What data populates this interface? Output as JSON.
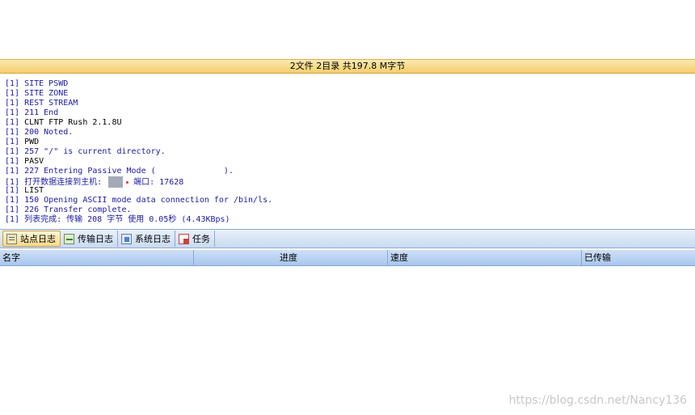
{
  "status_bar": {
    "text": "2文件 2目录 共197.8 M字节"
  },
  "log": [
    {
      "tag": "[1]",
      "text": " SITE PSWD",
      "color": "blue"
    },
    {
      "tag": "[1]",
      "text": " SITE ZONE",
      "color": "blue"
    },
    {
      "tag": "[1]",
      "text": " REST STREAM",
      "color": "blue"
    },
    {
      "tag": "[1]",
      "text": " 211 End",
      "color": "blue"
    },
    {
      "tag": "[1]",
      "text": " CLNT FTP Rush 2.1.8U",
      "color": "black"
    },
    {
      "tag": "[1]",
      "text": " 200 Noted.",
      "color": "blue"
    },
    {
      "tag": "[1]",
      "text": " PWD",
      "color": "black"
    },
    {
      "tag": "[1]",
      "text": " 257 \"/\" is current directory.",
      "color": "blue"
    },
    {
      "tag": "[1]",
      "text": " PASV",
      "color": "black"
    },
    {
      "tag": "[1]",
      "text": " 227 Entering Passive Mode (              ).",
      "color": "blue"
    },
    {
      "tag": "[1]",
      "text": " 打开数据连接到主机:",
      "color": "blue",
      "redacted": true,
      "suffix": "端口: 17628"
    },
    {
      "tag": "[1]",
      "text": " LIST",
      "color": "black"
    },
    {
      "tag": "[1]",
      "text": " 150 Opening ASCII mode data connection for /bin/ls.",
      "color": "blue"
    },
    {
      "tag": "[1]",
      "text": " 226 Transfer complete.",
      "color": "blue"
    },
    {
      "tag": "[1]",
      "text": " 列表完成: 传输 208 字节 使用 0.05秒 (4.43KBps)",
      "color": "blue"
    }
  ],
  "tabs": [
    {
      "label": "站点日志",
      "icon": "site-log-icon",
      "active": true
    },
    {
      "label": "传输日志",
      "icon": "transfer-log-icon",
      "active": false
    },
    {
      "label": "系统日志",
      "icon": "system-log-icon",
      "active": false
    },
    {
      "label": "任务",
      "icon": "task-icon",
      "active": false
    }
  ],
  "columns": [
    {
      "label": "名字"
    },
    {
      "label": "进度"
    },
    {
      "label": "速度"
    },
    {
      "label": "已传输"
    }
  ],
  "watermark": "https://blog.csdn.net/Nancy136",
  "colors": {
    "status_bar": "#f3cf6e",
    "log_blue": "#1a1aa6",
    "tab_bar": "#c9daf2",
    "header": "#a9c6ee"
  }
}
